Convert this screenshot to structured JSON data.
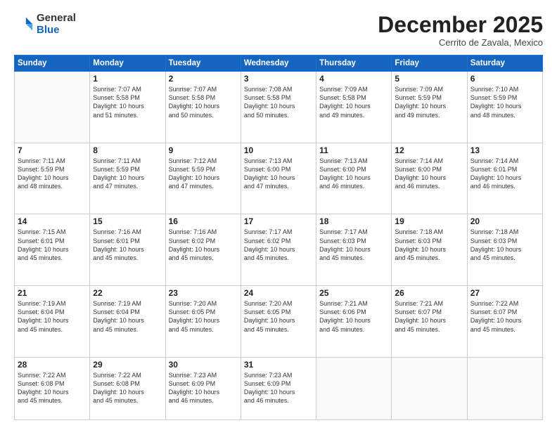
{
  "header": {
    "logo_general": "General",
    "logo_blue": "Blue",
    "month_title": "December 2025",
    "subtitle": "Cerrito de Zavala, Mexico"
  },
  "weekdays": [
    "Sunday",
    "Monday",
    "Tuesday",
    "Wednesday",
    "Thursday",
    "Friday",
    "Saturday"
  ],
  "weeks": [
    [
      {
        "day": "",
        "info": ""
      },
      {
        "day": "1",
        "info": "Sunrise: 7:07 AM\nSunset: 5:58 PM\nDaylight: 10 hours\nand 51 minutes."
      },
      {
        "day": "2",
        "info": "Sunrise: 7:07 AM\nSunset: 5:58 PM\nDaylight: 10 hours\nand 50 minutes."
      },
      {
        "day": "3",
        "info": "Sunrise: 7:08 AM\nSunset: 5:58 PM\nDaylight: 10 hours\nand 50 minutes."
      },
      {
        "day": "4",
        "info": "Sunrise: 7:09 AM\nSunset: 5:58 PM\nDaylight: 10 hours\nand 49 minutes."
      },
      {
        "day": "5",
        "info": "Sunrise: 7:09 AM\nSunset: 5:59 PM\nDaylight: 10 hours\nand 49 minutes."
      },
      {
        "day": "6",
        "info": "Sunrise: 7:10 AM\nSunset: 5:59 PM\nDaylight: 10 hours\nand 48 minutes."
      }
    ],
    [
      {
        "day": "7",
        "info": "Sunrise: 7:11 AM\nSunset: 5:59 PM\nDaylight: 10 hours\nand 48 minutes."
      },
      {
        "day": "8",
        "info": "Sunrise: 7:11 AM\nSunset: 5:59 PM\nDaylight: 10 hours\nand 47 minutes."
      },
      {
        "day": "9",
        "info": "Sunrise: 7:12 AM\nSunset: 5:59 PM\nDaylight: 10 hours\nand 47 minutes."
      },
      {
        "day": "10",
        "info": "Sunrise: 7:13 AM\nSunset: 6:00 PM\nDaylight: 10 hours\nand 47 minutes."
      },
      {
        "day": "11",
        "info": "Sunrise: 7:13 AM\nSunset: 6:00 PM\nDaylight: 10 hours\nand 46 minutes."
      },
      {
        "day": "12",
        "info": "Sunrise: 7:14 AM\nSunset: 6:00 PM\nDaylight: 10 hours\nand 46 minutes."
      },
      {
        "day": "13",
        "info": "Sunrise: 7:14 AM\nSunset: 6:01 PM\nDaylight: 10 hours\nand 46 minutes."
      }
    ],
    [
      {
        "day": "14",
        "info": "Sunrise: 7:15 AM\nSunset: 6:01 PM\nDaylight: 10 hours\nand 45 minutes."
      },
      {
        "day": "15",
        "info": "Sunrise: 7:16 AM\nSunset: 6:01 PM\nDaylight: 10 hours\nand 45 minutes."
      },
      {
        "day": "16",
        "info": "Sunrise: 7:16 AM\nSunset: 6:02 PM\nDaylight: 10 hours\nand 45 minutes."
      },
      {
        "day": "17",
        "info": "Sunrise: 7:17 AM\nSunset: 6:02 PM\nDaylight: 10 hours\nand 45 minutes."
      },
      {
        "day": "18",
        "info": "Sunrise: 7:17 AM\nSunset: 6:03 PM\nDaylight: 10 hours\nand 45 minutes."
      },
      {
        "day": "19",
        "info": "Sunrise: 7:18 AM\nSunset: 6:03 PM\nDaylight: 10 hours\nand 45 minutes."
      },
      {
        "day": "20",
        "info": "Sunrise: 7:18 AM\nSunset: 6:03 PM\nDaylight: 10 hours\nand 45 minutes."
      }
    ],
    [
      {
        "day": "21",
        "info": "Sunrise: 7:19 AM\nSunset: 6:04 PM\nDaylight: 10 hours\nand 45 minutes."
      },
      {
        "day": "22",
        "info": "Sunrise: 7:19 AM\nSunset: 6:04 PM\nDaylight: 10 hours\nand 45 minutes."
      },
      {
        "day": "23",
        "info": "Sunrise: 7:20 AM\nSunset: 6:05 PM\nDaylight: 10 hours\nand 45 minutes."
      },
      {
        "day": "24",
        "info": "Sunrise: 7:20 AM\nSunset: 6:05 PM\nDaylight: 10 hours\nand 45 minutes."
      },
      {
        "day": "25",
        "info": "Sunrise: 7:21 AM\nSunset: 6:06 PM\nDaylight: 10 hours\nand 45 minutes."
      },
      {
        "day": "26",
        "info": "Sunrise: 7:21 AM\nSunset: 6:07 PM\nDaylight: 10 hours\nand 45 minutes."
      },
      {
        "day": "27",
        "info": "Sunrise: 7:22 AM\nSunset: 6:07 PM\nDaylight: 10 hours\nand 45 minutes."
      }
    ],
    [
      {
        "day": "28",
        "info": "Sunrise: 7:22 AM\nSunset: 6:08 PM\nDaylight: 10 hours\nand 45 minutes."
      },
      {
        "day": "29",
        "info": "Sunrise: 7:22 AM\nSunset: 6:08 PM\nDaylight: 10 hours\nand 45 minutes."
      },
      {
        "day": "30",
        "info": "Sunrise: 7:23 AM\nSunset: 6:09 PM\nDaylight: 10 hours\nand 46 minutes."
      },
      {
        "day": "31",
        "info": "Sunrise: 7:23 AM\nSunset: 6:09 PM\nDaylight: 10 hours\nand 46 minutes."
      },
      {
        "day": "",
        "info": ""
      },
      {
        "day": "",
        "info": ""
      },
      {
        "day": "",
        "info": ""
      }
    ]
  ]
}
